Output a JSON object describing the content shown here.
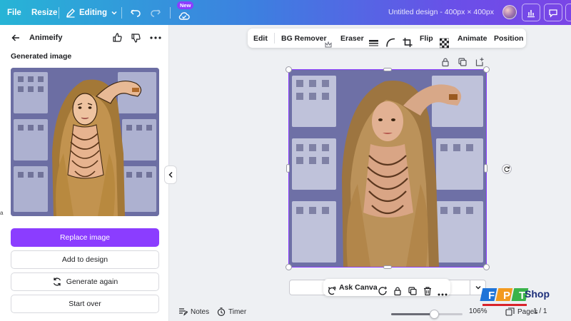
{
  "topbar": {
    "file": "File",
    "resize": "Resize",
    "mode": "Editing",
    "new_badge": "New",
    "doc_title": "Untitled design - 400px × 400px"
  },
  "panel": {
    "title": "Animeify",
    "generated_label": "Generated image",
    "replace_button": "Replace image",
    "add_button": "Add to design",
    "generate_again_button": "Generate again",
    "start_over_button": "Start over"
  },
  "context_toolbar": {
    "edit": "Edit",
    "bg_remover": "BG Remover",
    "eraser": "Eraser",
    "flip": "Flip",
    "animate": "Animate",
    "position": "Position"
  },
  "float_toolbar": {
    "ask_canva": "Ask Canva"
  },
  "bottom": {
    "notes": "Notes",
    "timer": "Timer",
    "zoom_value": 106,
    "zoom_label": "106%",
    "pages": "Pages",
    "page_count": "1 / 1"
  },
  "watermark": {
    "shop": "Shop"
  },
  "colors": {
    "accent": "#8b3dff",
    "topbar_start": "#27b4d6",
    "topbar_end": "#7a45e6"
  }
}
